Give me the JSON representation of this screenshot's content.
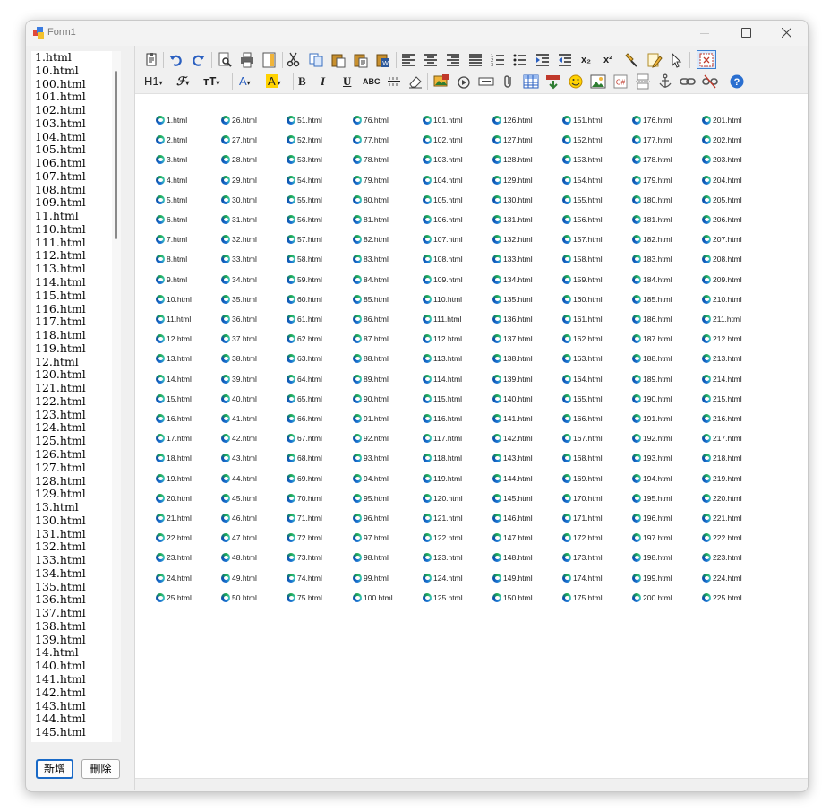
{
  "window": {
    "title": "Form1"
  },
  "listbox": {
    "items": [
      "1.html",
      "10.html",
      "100.html",
      "101.html",
      "102.html",
      "103.html",
      "104.html",
      "105.html",
      "106.html",
      "107.html",
      "108.html",
      "109.html",
      "11.html",
      "110.html",
      "111.html",
      "112.html",
      "113.html",
      "114.html",
      "115.html",
      "116.html",
      "117.html",
      "118.html",
      "119.html",
      "12.html",
      "120.html",
      "121.html",
      "122.html",
      "123.html",
      "124.html",
      "125.html",
      "126.html",
      "127.html",
      "128.html",
      "129.html",
      "13.html",
      "130.html",
      "131.html",
      "132.html",
      "133.html",
      "134.html",
      "135.html",
      "136.html",
      "137.html",
      "138.html",
      "139.html",
      "14.html",
      "140.html",
      "141.html",
      "142.html",
      "143.html",
      "144.html",
      "145.html"
    ]
  },
  "buttons": {
    "add_label": "新增",
    "delete_label": "刪除"
  },
  "toolbar": {
    "heading_label": "H1",
    "font_label": "ℱ",
    "size_label": "ᴛT",
    "font_color_label": "A",
    "highlight_label": "A",
    "bold_label": "B",
    "italic_label": "I",
    "underline_label": "U",
    "strike_label": "ABC",
    "subscript_label": "x₂",
    "superscript_label": "x²",
    "accent_highlight": "#ffd200",
    "accent_blue": "#1a6ac7"
  },
  "content": {
    "columns": 9,
    "rows": 25,
    "files": [
      "1.html",
      "2.html",
      "3.html",
      "4.html",
      "5.html",
      "6.html",
      "7.html",
      "8.html",
      "9.html",
      "10.html",
      "11.html",
      "12.html",
      "13.html",
      "14.html",
      "15.html",
      "16.html",
      "17.html",
      "18.html",
      "19.html",
      "20.html",
      "21.html",
      "22.html",
      "23.html",
      "24.html",
      "25.html",
      "26.html",
      "27.html",
      "28.html",
      "29.html",
      "30.html",
      "31.html",
      "32.html",
      "33.html",
      "34.html",
      "35.html",
      "36.html",
      "37.html",
      "38.html",
      "39.html",
      "40.html",
      "41.html",
      "42.html",
      "43.html",
      "44.html",
      "45.html",
      "46.html",
      "47.html",
      "48.html",
      "49.html",
      "50.html",
      "51.html",
      "52.html",
      "53.html",
      "54.html",
      "55.html",
      "56.html",
      "57.html",
      "58.html",
      "59.html",
      "60.html",
      "61.html",
      "62.html",
      "63.html",
      "64.html",
      "65.html",
      "66.html",
      "67.html",
      "68.html",
      "69.html",
      "70.html",
      "71.html",
      "72.html",
      "73.html",
      "74.html",
      "75.html",
      "76.html",
      "77.html",
      "78.html",
      "79.html",
      "80.html",
      "81.html",
      "82.html",
      "83.html",
      "84.html",
      "85.html",
      "86.html",
      "87.html",
      "88.html",
      "89.html",
      "90.html",
      "91.html",
      "92.html",
      "93.html",
      "94.html",
      "95.html",
      "96.html",
      "97.html",
      "98.html",
      "99.html",
      "100.html",
      "101.html",
      "102.html",
      "103.html",
      "104.html",
      "105.html",
      "106.html",
      "107.html",
      "108.html",
      "109.html",
      "110.html",
      "111.html",
      "112.html",
      "113.html",
      "114.html",
      "115.html",
      "116.html",
      "117.html",
      "118.html",
      "119.html",
      "120.html",
      "121.html",
      "122.html",
      "123.html",
      "124.html",
      "125.html",
      "126.html",
      "127.html",
      "128.html",
      "129.html",
      "130.html",
      "131.html",
      "132.html",
      "133.html",
      "134.html",
      "135.html",
      "136.html",
      "137.html",
      "138.html",
      "139.html",
      "140.html",
      "141.html",
      "142.html",
      "143.html",
      "144.html",
      "145.html",
      "146.html",
      "147.html",
      "148.html",
      "149.html",
      "150.html",
      "151.html",
      "152.html",
      "153.html",
      "154.html",
      "155.html",
      "156.html",
      "157.html",
      "158.html",
      "159.html",
      "160.html",
      "161.html",
      "162.html",
      "163.html",
      "164.html",
      "165.html",
      "166.html",
      "167.html",
      "168.html",
      "169.html",
      "170.html",
      "171.html",
      "172.html",
      "173.html",
      "174.html",
      "175.html",
      "176.html",
      "177.html",
      "178.html",
      "179.html",
      "180.html",
      "181.html",
      "182.html",
      "183.html",
      "184.html",
      "185.html",
      "186.html",
      "187.html",
      "188.html",
      "189.html",
      "190.html",
      "191.html",
      "192.html",
      "193.html",
      "194.html",
      "195.html",
      "196.html",
      "197.html",
      "198.html",
      "199.html",
      "200.html",
      "201.html",
      "202.html",
      "203.html",
      "204.html",
      "205.html",
      "206.html",
      "207.html",
      "208.html",
      "209.html",
      "210.html",
      "211.html",
      "212.html",
      "213.html",
      "214.html",
      "215.html",
      "216.html",
      "217.html",
      "218.html",
      "219.html",
      "220.html",
      "221.html",
      "222.html",
      "223.html",
      "224.html",
      "225.html"
    ]
  }
}
